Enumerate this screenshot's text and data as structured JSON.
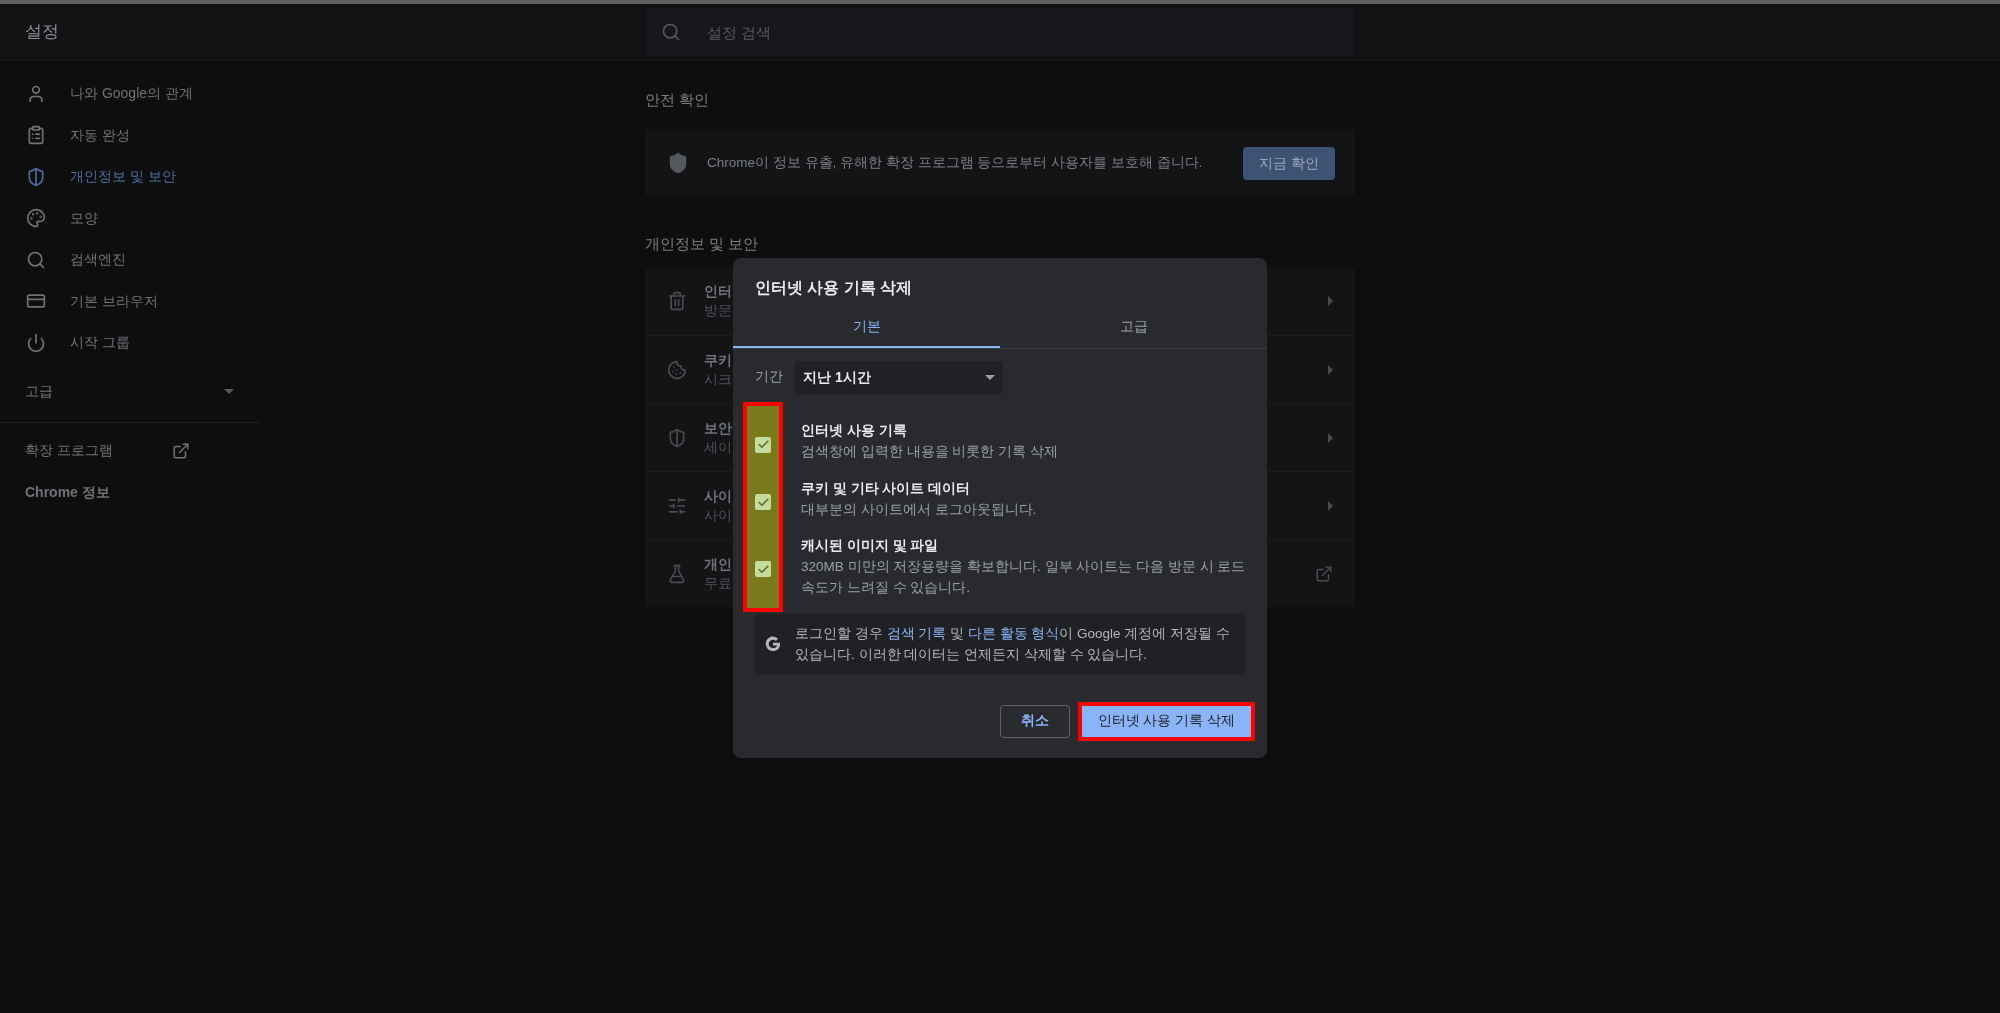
{
  "header": {
    "title": "설정"
  },
  "search": {
    "placeholder": "설정 검색"
  },
  "sidebar": {
    "items": [
      {
        "label": "나와 Google의 관계",
        "selected": false
      },
      {
        "label": "자동 완성",
        "selected": false
      },
      {
        "label": "개인정보 및 보안",
        "selected": true
      },
      {
        "label": "모양",
        "selected": false
      },
      {
        "label": "검색엔진",
        "selected": false
      },
      {
        "label": "기본 브라우저",
        "selected": false
      },
      {
        "label": "시작 그룹",
        "selected": false
      }
    ],
    "advanced": {
      "label": "고급",
      "expanded": false
    },
    "extensions": "확장 프로그램",
    "about": "Chrome 정보"
  },
  "safety_check": {
    "heading": "안전 확인",
    "text": "Chrome이 정보 유출, 유해한 확장 프로그램 등으로부터 사용자를 보호해 줍니다.",
    "button": "지금 확인"
  },
  "privacy": {
    "heading": "개인정보 및 보안",
    "rows": [
      {
        "title": "인터",
        "subtitle": "방문",
        "kind": "arrow"
      },
      {
        "title": "쿠키",
        "subtitle": "시크",
        "kind": "arrow"
      },
      {
        "title": "보안",
        "subtitle": "세이",
        "kind": "arrow"
      },
      {
        "title": "사이",
        "subtitle": "사이",
        "kind": "arrow"
      },
      {
        "title": "개인",
        "subtitle": "무료",
        "kind": "external"
      }
    ]
  },
  "dialog": {
    "title": "인터넷 사용 기록 삭제",
    "tabs": [
      {
        "label": "기본",
        "selected": true
      },
      {
        "label": "고급",
        "selected": false
      }
    ],
    "period": {
      "label": "기간",
      "value": "지난 1시간"
    },
    "checkboxes_highlighted": true,
    "options": [
      {
        "title": "인터넷 사용 기록",
        "description": "검색창에 입력한 내용을 비롯한 기록 삭제",
        "checked": true
      },
      {
        "title": "쿠키 및 기타 사이트 데이터",
        "description": "대부분의 사이트에서 로그아웃됩니다.",
        "checked": true
      },
      {
        "title": "캐시된 이미지 및 파일",
        "description": "320MB 미만의 저장용량을 확보합니다. 일부 사이트는 다음 방문 시 로드 속도가 느려질 수 있습니다.",
        "checked": true
      }
    ],
    "notice": [
      {
        "text": "로그인할 경우 ",
        "link": false
      },
      {
        "text": "검색 기록",
        "link": true
      },
      {
        "text": " 및 ",
        "link": false
      },
      {
        "text": "다른 활동 형식",
        "link": true
      },
      {
        "text": "이 Google 계정에 저장될 수 있습니다. 이러한 데이터는 언제든지 삭제할 수 있습니다.",
        "link": false
      }
    ],
    "cancel": "취소",
    "confirm": {
      "label": "인터넷 사용 기록 삭제",
      "highlighted": true
    }
  }
}
